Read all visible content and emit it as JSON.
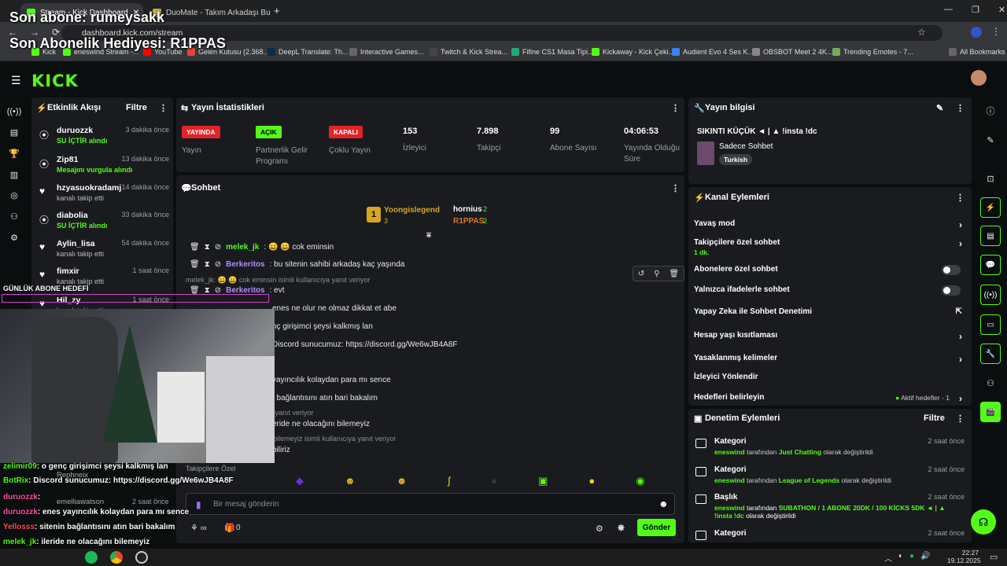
{
  "browser": {
    "tabs": [
      {
        "label": "Stream - Kick Dashboard",
        "active": true
      },
      {
        "label": "DuoMate - Takım Arkadaşı Bul",
        "active": false
      }
    ],
    "url": "dashboard.kick.com/stream",
    "bookmarks": [
      "Kick",
      "eneswind Stream -...",
      "YouTube",
      "Gelen Kutusu (2.368...",
      "DeepL Translate: Th...",
      "Interactive Games...",
      "Twitch & Kick Strea...",
      "Fifine CS1 Masa Tipi...",
      "Kickaway - Kick Çeki...",
      "Audient Evo 4 Ses K...",
      "OBSBOT Meet 2 4K...",
      "Trending Emotes - 7...",
      "All Bookmarks"
    ]
  },
  "overlay": {
    "last_sub": "Son abone: rumeysakk",
    "last_gift": "Son Abonelik Hediyesi: R1PPAS",
    "daily_goal": "GÜNLÜK ABONE HEDEFİ",
    "chat": [
      {
        "user": "zelimir09",
        "msg": ": o genç girişimci şeysi kalkmış lan",
        "color": "#53fc18"
      },
      {
        "user": "BotRix",
        "msg": ": Discord sunucumuz: https://discord.gg/We6wJB4A8F",
        "color": "#53fc18"
      },
      {
        "user": "duruozzk",
        "msg": ":",
        "color": "#ff4fa3"
      },
      {
        "user": "duruozzk",
        "msg": ": enes yayıncılık kolaydan para mı sence",
        "color": "#ff4fa3"
      },
      {
        "user": "Yellosss",
        "msg": ": sitenin bağlantısını atın bari bakalım",
        "color": "#ff4f4f"
      },
      {
        "user": "melek_jk",
        "msg": ": ileride ne olacağını bilemeyiz",
        "color": "#53fc18"
      },
      {
        "user": "Berkeritos",
        "msg": ": biliriz",
        "color": "#b18cff"
      }
    ]
  },
  "activity": {
    "title": "Etkinlik Akışı",
    "filter": "Filtre",
    "items": [
      {
        "name": "duruozzk",
        "sub": "SU İÇTİR alındı",
        "time": "3 dakika önce",
        "green": true
      },
      {
        "name": "Zip81",
        "sub": "Mesajını vurgula alındı",
        "time": "13 dakika önce",
        "green": true
      },
      {
        "name": "hzyasuokradamj",
        "sub": "kanalı takip etti",
        "time": "14 dakika önce",
        "green": false
      },
      {
        "name": "diabolia",
        "sub": "SU İÇTİR alındı",
        "time": "33 dakika önce",
        "green": true
      },
      {
        "name": "Aylin_lisa",
        "sub": "kanalı takip etti",
        "time": "54 dakika önce",
        "green": false
      },
      {
        "name": "fimxir",
        "sub": "kanalı takip etti",
        "time": "1 saat önce",
        "green": false
      },
      {
        "name": "Hil_zy",
        "sub": "kanalı takip etti",
        "time": "1 saat önce",
        "green": false
      }
    ]
  },
  "stats": {
    "title": "Yayın İstatistikleri",
    "items": [
      {
        "badge": "YAYINDA",
        "badge_color": "#e0242a",
        "label": "Yayın"
      },
      {
        "badge": "AÇIK",
        "badge_color": "#53fc18",
        "label": "Partnerlik Gelir Programı"
      },
      {
        "badge": "KAPALI",
        "badge_color": "#e0242a",
        "label": "Çoklu Yayın"
      },
      {
        "value": "153",
        "label": "İzleyici"
      },
      {
        "value": "7.898",
        "label": "Takipçi"
      },
      {
        "value": "99",
        "label": "Abone Sayısı"
      },
      {
        "value": "04:06:53",
        "label": "Yayında Olduğu Süre"
      }
    ]
  },
  "chat": {
    "title": "Sohbet",
    "leaders": [
      {
        "name": "Yoongislegend",
        "count": "3"
      },
      {
        "name": "hornius",
        "count": "2"
      },
      {
        "name": "R1PPAS",
        "count": "2"
      }
    ],
    "lines": [
      {
        "user": "melek_jk",
        "msg": ": 😄 😄 cok eminsin",
        "color": "#53fc18"
      },
      {
        "user": "Berkeritos",
        "msg": ": bu sitenin sahibi arkadaş kaç yaşında",
        "color": "#b18cff"
      },
      {
        "reply": "melek_jk: 😄 😄 cok eminsin isimli kullanıcıya yanıt veriyor"
      },
      {
        "user": "Berkeritos",
        "msg": ": evt",
        "color": "#b18cff"
      },
      {
        "user": "",
        "msg": "enes ne olur ne olmaz dikkat et abe",
        "color": "#b18cff"
      },
      {
        "user": "",
        "msg": "nç girişimci şeysi kalkmış lan",
        "color": "#fff"
      },
      {
        "user": "",
        "msg": "Discord sunucumuz: https://discord.gg/We6wJB4A8F",
        "color": "#fff"
      },
      {
        "user": "",
        "msg": "yayıncılık kolaydan para mı sence",
        "color": "#fff"
      },
      {
        "user": "",
        "msg": "ı bağlantısını atın bari bakalım",
        "color": "#fff"
      },
      {
        "reply": "a yanıt veriyor"
      },
      {
        "user": "",
        "msg": "eride ne olacağını bilemeyiz",
        "color": "#fff"
      },
      {
        "reply": "ı bilemeyiz isimli kullanıcıya yanıt veriyor"
      },
      {
        "user": "",
        "msg": "biliriz",
        "color": "#fff"
      }
    ],
    "followers_only": "Takipçilere Özel",
    "placeholder": "Bir mesaj gönderin",
    "send": "Gönder",
    "count_zero": "0",
    "partial_users": [
      "Rephneix",
      "emelliawatson"
    ],
    "partial_time": "2 saat önce"
  },
  "stream_info": {
    "title": "Yayın bilgisi",
    "stream_title": "SIKINTI KÜÇÜK ◄ | ▲ !insta !dc",
    "category": "Sadece Sohbet",
    "tag": "Turkish"
  },
  "channel_actions": {
    "title": "Kanal Eylemleri",
    "items": [
      {
        "label": "Yavaş mod",
        "type": "chev"
      },
      {
        "label": "Takipçilere özel sohbet",
        "sub": "1 dk.",
        "type": "chev"
      },
      {
        "label": "Abonelere özel sohbet",
        "type": "toggle"
      },
      {
        "label": "Yalnızca ifadelerle sohbet",
        "type": "toggle"
      },
      {
        "label": "Yapay Zeka ile Sohbet Denetimi",
        "type": "ext"
      },
      {
        "label": "Hesap yaşı kısıtlaması",
        "type": "chev"
      },
      {
        "label": "Yasaklanmış kelimeler",
        "type": "chev"
      },
      {
        "label": "İzleyici Yönlendir",
        "type": "none"
      },
      {
        "label": "Hedefleri belirleyin",
        "type": "chev",
        "extra": "Aktif hedefler - 1"
      }
    ]
  },
  "mod_actions": {
    "title": "Denetim Eylemleri",
    "filter": "Filtre",
    "items": [
      {
        "title": "Kategori",
        "user": "eneswind",
        "mid": " tarafından ",
        "value": "Just Chatting",
        "end": " olarak değiştirildi",
        "time": "2 saat önce"
      },
      {
        "title": "Kategori",
        "user": "eneswind",
        "mid": " tarafından ",
        "value": "League of Legends",
        "end": " olarak değiştirildi",
        "time": "2 saat önce"
      },
      {
        "title": "Başlık",
        "user": "eneswind",
        "mid": " tarafından ",
        "value": "SUBATHON / 1 ABONE 20DK / 100 KİCKS 5DK ◄ | ▲ !insta !dc",
        "end": " olarak değiştirildi",
        "time": "2 saat önce"
      },
      {
        "title": "Kategori",
        "time": "2 saat önce"
      }
    ]
  },
  "taskbar": {
    "time": "22:27",
    "date": "19.12.2025"
  }
}
